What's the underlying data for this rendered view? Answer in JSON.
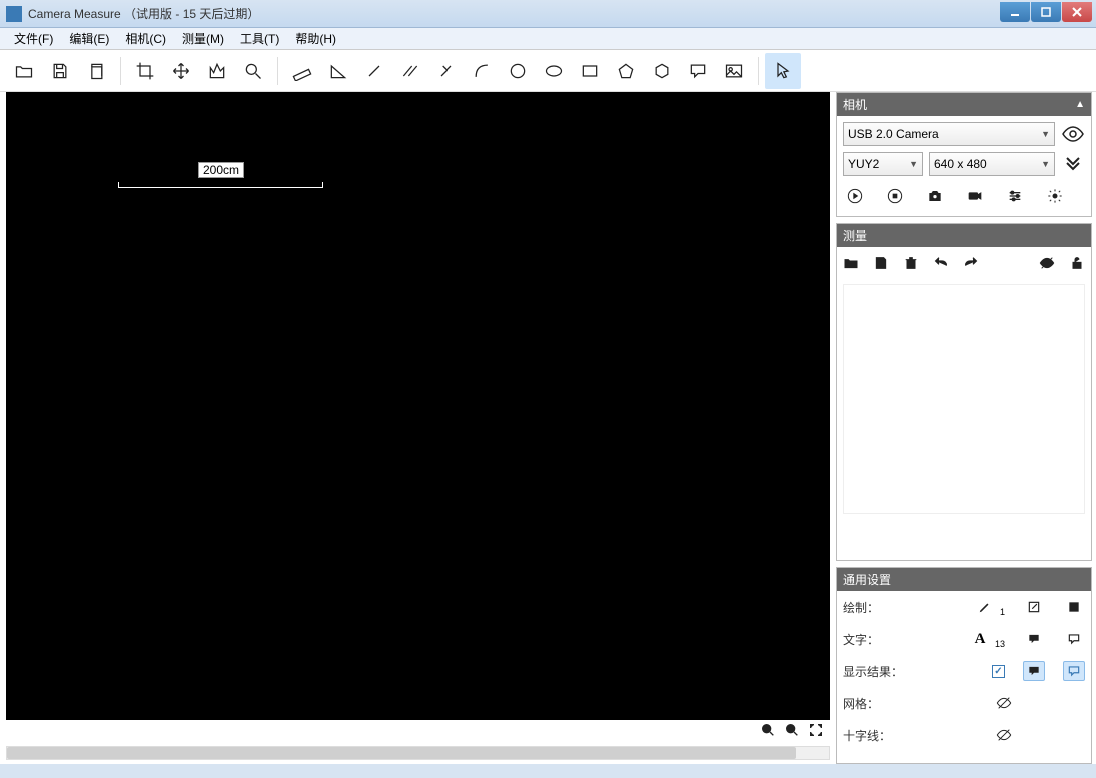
{
  "window": {
    "title": "Camera Measure （试用版 - 15 天后过期）"
  },
  "menu": {
    "file": "文件(F)",
    "edit": "编辑(E)",
    "camera": "相机(C)",
    "measure": "测量(M)",
    "tools": "工具(T)",
    "help": "帮助(H)"
  },
  "canvas": {
    "measurement_label": "200cm"
  },
  "panels": {
    "camera": {
      "title": "相机",
      "device": "USB 2.0 Camera",
      "format": "YUY2",
      "resolution": "640 x 480"
    },
    "measure": {
      "title": "测量"
    },
    "settings": {
      "title": "通用设置",
      "draw_label": "绘制：",
      "draw_size": "1",
      "text_label": "文字：",
      "text_size": "13",
      "result_label": "显示结果：",
      "grid_label": "网格：",
      "crosshair_label": "十字线："
    }
  }
}
